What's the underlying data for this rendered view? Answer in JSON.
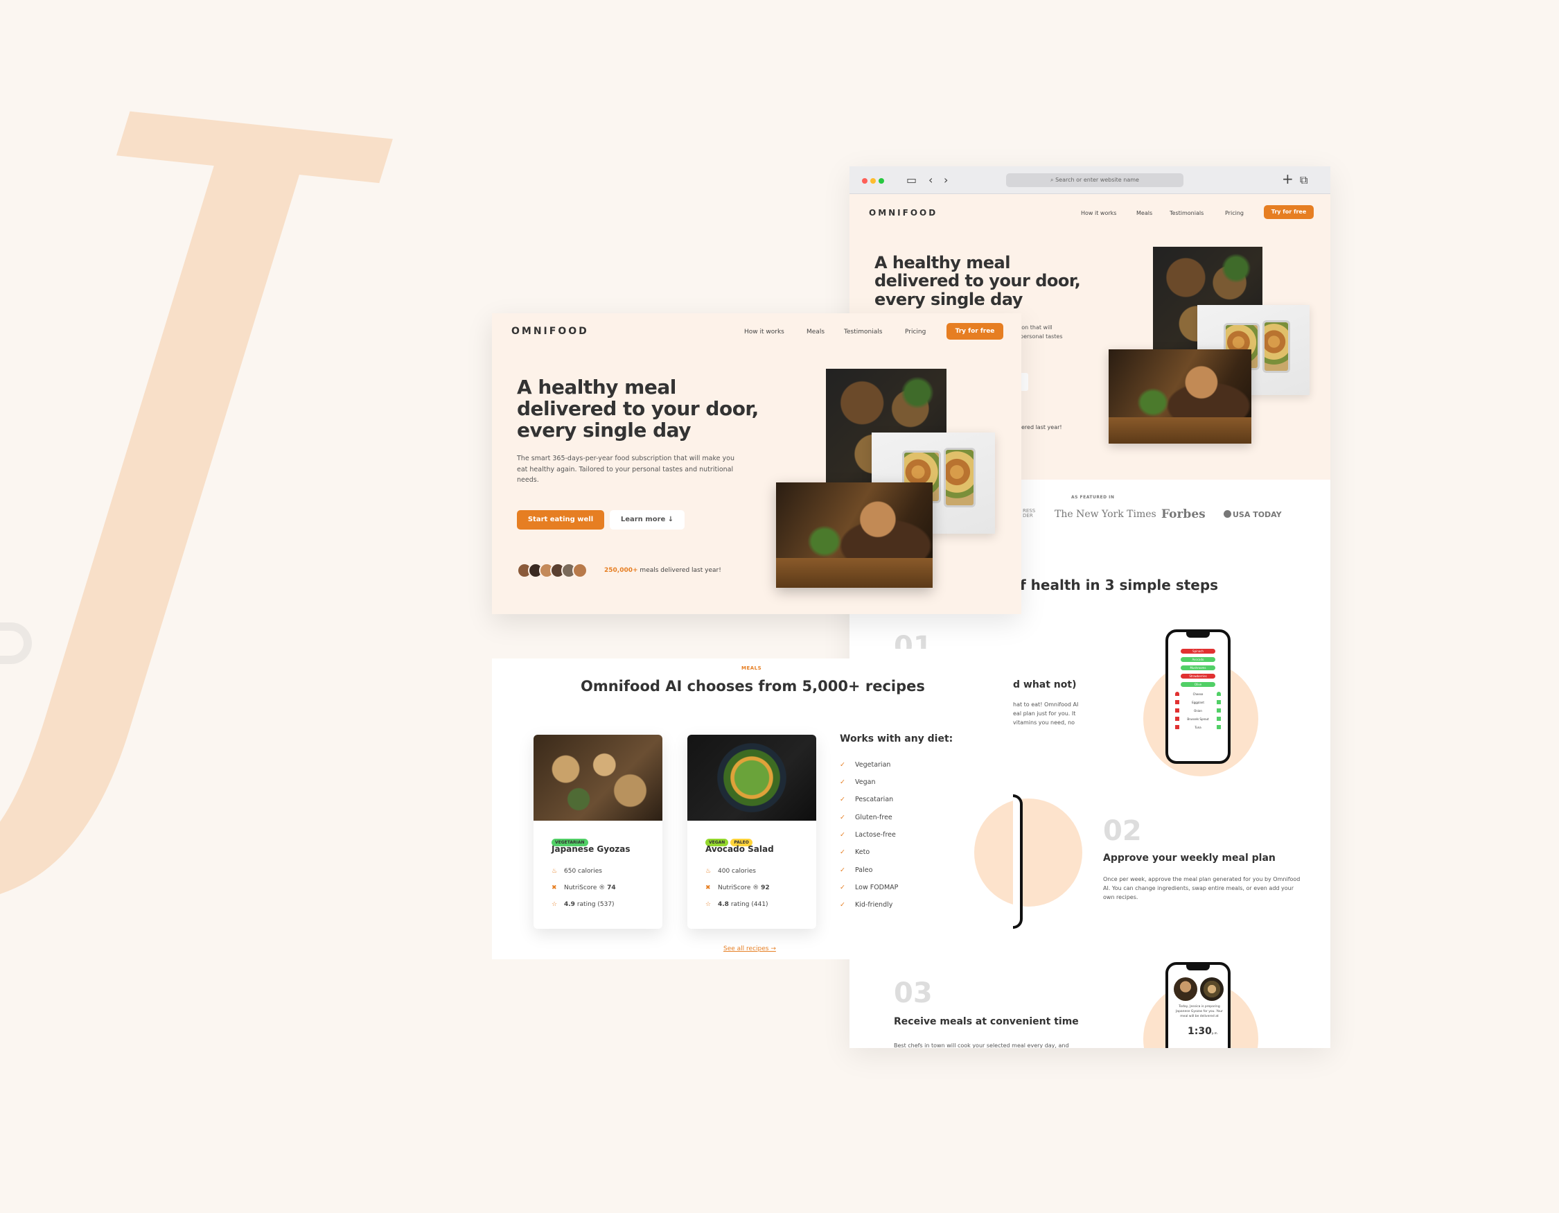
{
  "brand": {
    "logo": "OMNIFOOD",
    "accent": "#e67e22",
    "background": "#fdf2e9",
    "decoration": "J",
    "decoration_color": "#f8dcc2"
  },
  "nav": {
    "links": [
      "How it works",
      "Meals",
      "Testimonials",
      "Pricing"
    ],
    "cta": "Try for free"
  },
  "browser": {
    "url_placeholder": "Search or enter website name",
    "icons": [
      "sidebar-icon",
      "back-icon",
      "forward-icon",
      "new-tab-icon",
      "tabs-icon"
    ]
  },
  "hero": {
    "title_lines": [
      "A healthy meal",
      "delivered to your door,",
      "every single day"
    ],
    "description": "The smart 365-days-per-year food subscription that will make you eat healthy again. Tailored to your personal tastes and nutritional needs.",
    "primary_button": "Start eating well",
    "secondary_button": "Learn more ↓",
    "delivered_count": "250,000+",
    "delivered_text": "meals delivered last year!",
    "partial_desc_1": "ion that will",
    "partial_desc_2": "personal tastes",
    "partial_delivered": "ered last year!"
  },
  "featured": {
    "label": "AS FEATURED IN",
    "logos": [
      "The New York Times",
      "Forbes",
      "USA TODAY"
    ],
    "partial_logo_1": "RESS",
    "partial_logo_2": "DER"
  },
  "how_it_works": {
    "heading_partial": "f health in 3 simple steps",
    "step1": {
      "number": "01",
      "title_partial": "d what not)",
      "text_partial": [
        "hat to eat! Omnifood AI",
        "eal plan just for you. It",
        "vitamins you need, no"
      ]
    },
    "step2": {
      "number": "02",
      "title": "Approve your weekly meal plan",
      "text": "Once per week, approve the meal plan generated for you by Omnifood AI. You can change ingredients, swap entire meals, or even add your own recipes."
    },
    "step3": {
      "number": "03",
      "title": "Receive meals at convenient time",
      "text_partial": "Best chefs in town will cook your selected meal every day, and"
    },
    "phone1_items": [
      "Spinach",
      "Avocado",
      "Mushrooms",
      "Strawberries",
      "Olive",
      "Cheese",
      "Eggplant",
      "Onion",
      "Brussels Sprout",
      "Tuna"
    ],
    "phone2_text": "Today, Jessica is preparing Japanese Gyozas for you. Your meal will be delivered at",
    "phone2_time": "1:30",
    "phone2_ampm": "p.m."
  },
  "meals": {
    "label": "MEALS",
    "heading": "Omnifood AI chooses from 5,000+ recipes",
    "cards": [
      {
        "tags": [
          "VEGETARIAN"
        ],
        "tag_colors": [
          "#51cf66"
        ],
        "title": "Japanese Gyozas",
        "calories": "650 calories",
        "nutri": "NutriScore ®",
        "nutri_value": "74",
        "rating_value": "4.9",
        "rating_rest": "rating (537)"
      },
      {
        "tags": [
          "VEGAN",
          "PALEO"
        ],
        "tag_colors": [
          "#94d82d",
          "#ffd43b"
        ],
        "title": "Avocado Salad",
        "calories": "400 calories",
        "nutri": "NutriScore ®",
        "nutri_value": "92",
        "rating_value": "4.8",
        "rating_rest": "rating (441)"
      }
    ],
    "diet_heading": "Works with any diet:",
    "diets": [
      "Vegetarian",
      "Vegan",
      "Pescatarian",
      "Gluten-free",
      "Lactose-free",
      "Keto",
      "Paleo",
      "Low FODMAP",
      "Kid-friendly"
    ],
    "see_all": "See all recipes →"
  }
}
